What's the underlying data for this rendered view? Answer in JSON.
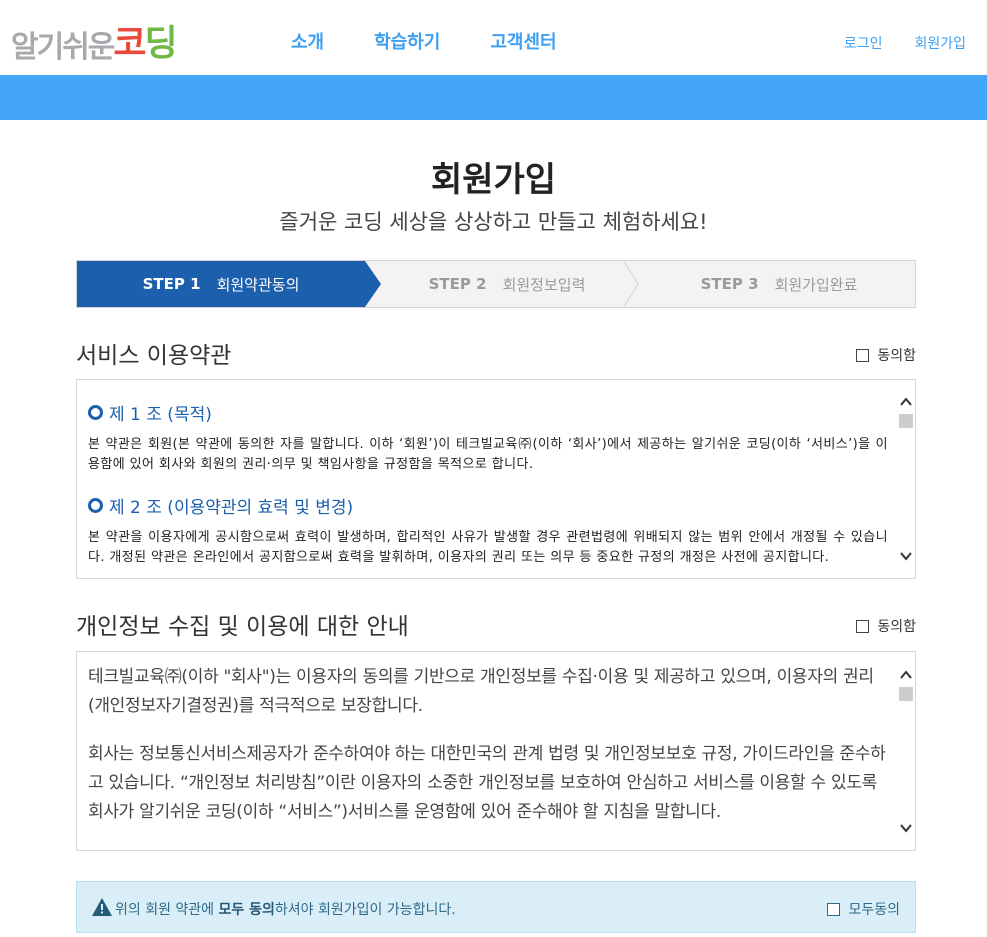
{
  "logo": {
    "part1": "알기쉬운",
    "part2a": "코",
    "part2b": "딩",
    "colors": [
      "#a7a9ac",
      "#e84b3c",
      "#f6a81c",
      "#71b945"
    ]
  },
  "nav": {
    "items": [
      "소개",
      "학습하기",
      "고객센터"
    ]
  },
  "user": {
    "login": "로그인",
    "signup": "회원가입"
  },
  "page": {
    "title": "회원가입",
    "subtitle": "즐거운 코딩 세상을 상상하고 만들고 체험하세요!"
  },
  "steps": [
    {
      "num": "STEP 1",
      "label": "회원약관동의",
      "active": true
    },
    {
      "num": "STEP 2",
      "label": "회원정보입력",
      "active": false
    },
    {
      "num": "STEP 3",
      "label": "회원가입완료",
      "active": false
    }
  ],
  "terms": {
    "title": "서비스 이용약관",
    "agree_label": "동의함",
    "articles": [
      {
        "title": "제 1 조 (목적)",
        "body": "본 약관은 회원(본 약관에 동의한 자를 말합니다. 이하 ‘회원’)이 테크빌교육㈜(이하 ‘회사’)에서 제공하는 알기쉬운 코딩(이하 ‘서비스’)을 이용함에 있어 회사와 회원의 권리·의무 및 책임사항을 규정함을 목적으로 합니다."
      },
      {
        "title": "제 2 조 (이용약관의 효력 및 변경)",
        "body": "본 약관을 이용자에게 공시함으로써 효력이 발생하며, 합리적인 사유가 발생할 경우 관련법령에 위배되지 않는 범위 안에서 개정될 수 있습니다. 개정된 약관은 온라인에서 공지함으로써 효력을 발휘하며, 이용자의 권리 또는 의무 등 중요한 규정의 개정은 사전에 공지합니다."
      }
    ]
  },
  "privacy": {
    "title": "개인정보 수집 및 이용에 대한 안내",
    "agree_label": "동의함",
    "paragraphs": [
      "테크빌교육㈜(이하 \"회사\")는 이용자의 동의를 기반으로 개인정보를 수집·이용 및 제공하고 있으며, 이용자의 권리(개인정보자기결정권)를 적극적으로 보장합니다.",
      "회사는 정보통신서비스제공자가 준수하여야 하는 대한민국의 관계 법령 및 개인정보보호 규정, 가이드라인을 준수하고 있습니다. “개인정보 처리방침”이란 이용자의 소중한 개인정보를 보호하여 안심하고 서비스를 이용할 수 있도록 회사가 알기쉬운 코딩(이하 “서비스”)서비스를 운영함에 있어 준수해야 할 지침을 말합니다."
    ]
  },
  "notice": {
    "pre": "위의 회원 약관에 ",
    "bold": "모두 동의",
    "post": "하셔야 회원가입이 가능합니다.",
    "agree_all": "모두동의"
  },
  "colors": {
    "accent": "#3fa0f2",
    "band": "#42a5f5",
    "step_active": "#1b5fad",
    "notice_bg": "#daeef7"
  },
  "icons": {
    "warning": "warning-icon",
    "scroll_up": "chevron-up-icon",
    "scroll_down": "chevron-down-icon",
    "article": "circle-icon"
  }
}
